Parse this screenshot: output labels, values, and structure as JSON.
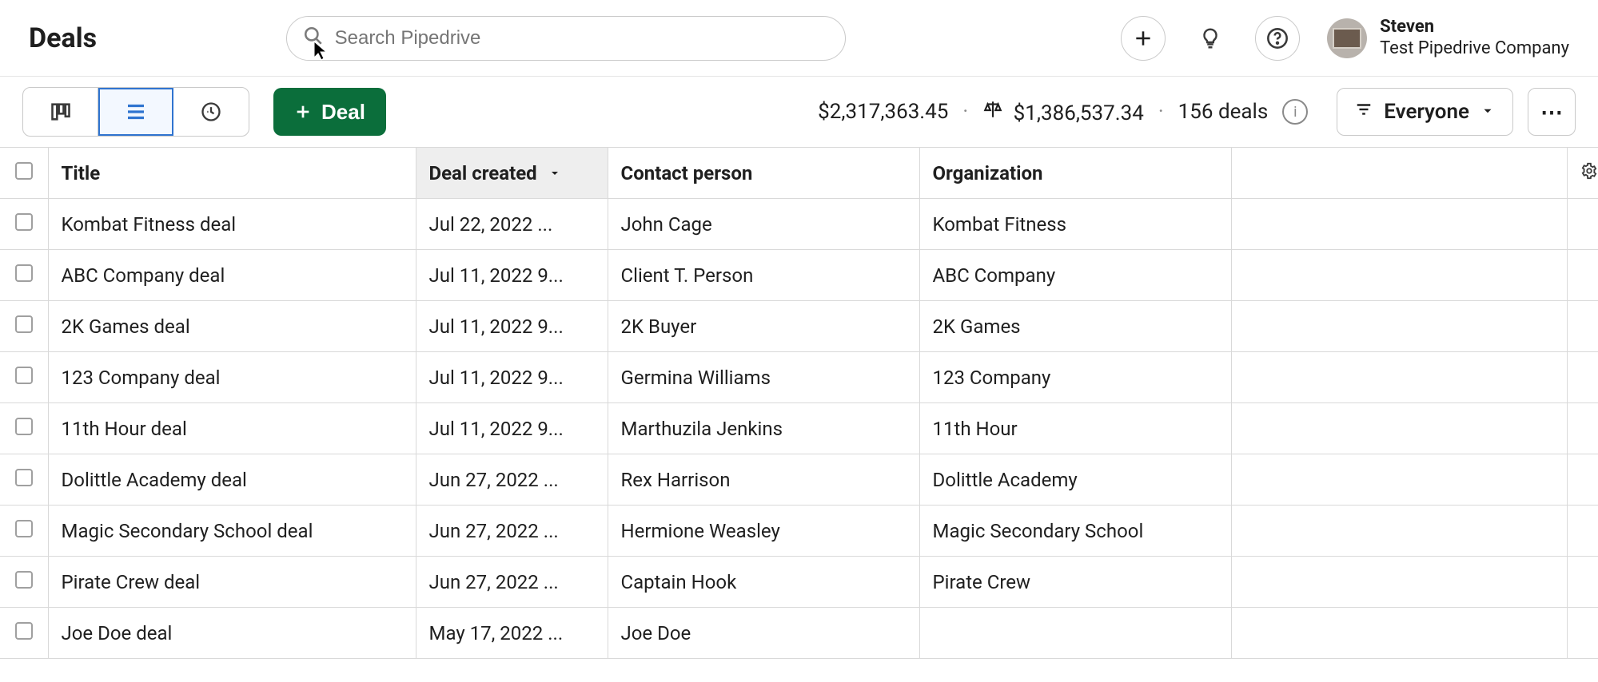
{
  "header": {
    "title": "Deals",
    "search_placeholder": "Search Pipedrive",
    "user": {
      "name": "Steven",
      "company": "Test Pipedrive Company"
    }
  },
  "toolbar": {
    "add_label": "Deal",
    "total_value": "$2,317,363.45",
    "weighted_value": "$1,386,537.34",
    "deal_count": "156 deals",
    "filter_label": "Everyone"
  },
  "columns": {
    "title": "Title",
    "created": "Deal created",
    "contact": "Contact person",
    "organization": "Organization"
  },
  "rows": [
    {
      "title": "Kombat Fitness deal",
      "created": "Jul 22, 2022 ...",
      "contact": "John Cage",
      "organization": "Kombat Fitness"
    },
    {
      "title": "ABC Company deal",
      "created": "Jul 11, 2022 9...",
      "contact": "Client T. Person",
      "organization": "ABC Company"
    },
    {
      "title": "2K Games deal",
      "created": "Jul 11, 2022 9...",
      "contact": "2K Buyer",
      "organization": "2K Games"
    },
    {
      "title": "123 Company deal",
      "created": "Jul 11, 2022 9...",
      "contact": "Germina Williams",
      "organization": "123 Company"
    },
    {
      "title": "11th Hour deal",
      "created": "Jul 11, 2022 9...",
      "contact": "Marthuzila Jenkins",
      "organization": "11th Hour"
    },
    {
      "title": "Dolittle Academy deal",
      "created": "Jun 27, 2022 ...",
      "contact": "Rex Harrison",
      "organization": "Dolittle Academy"
    },
    {
      "title": "Magic Secondary School deal",
      "created": "Jun 27, 2022 ...",
      "contact": "Hermione Weasley",
      "organization": "Magic Secondary School"
    },
    {
      "title": "Pirate Crew deal",
      "created": "Jun 27, 2022 ...",
      "contact": "Captain Hook",
      "organization": "Pirate Crew"
    },
    {
      "title": "Joe Doe deal",
      "created": "May 17, 2022 ...",
      "contact": "Joe Doe",
      "organization": ""
    }
  ]
}
